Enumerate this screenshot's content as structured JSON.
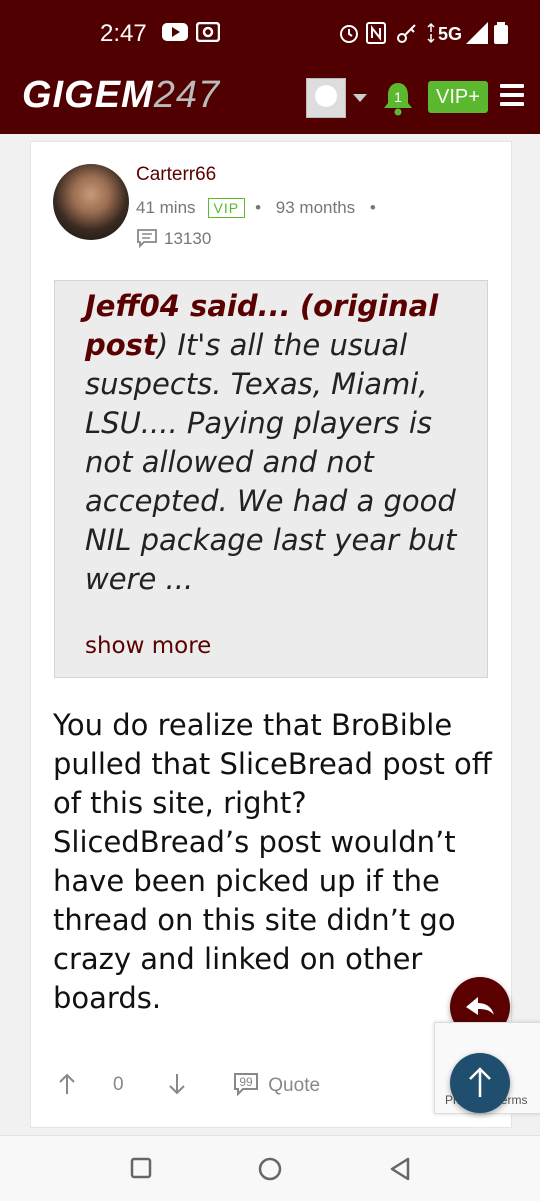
{
  "status_bar": {
    "time": "2:47",
    "network": "5G",
    "icons": [
      "youtube-icon",
      "cast-icon",
      "alarm-icon",
      "nfc-icon",
      "key-icon",
      "data-arrows-icon",
      "signal-icon",
      "battery-icon"
    ]
  },
  "header": {
    "logo_main": "GIGEM",
    "logo_num": "247",
    "notification_count": "1",
    "vip_label": "VIP+"
  },
  "post": {
    "username": "Carterr66",
    "time_ago": "41 mins",
    "vip_badge": "VIP",
    "tenure": "93 months",
    "post_count": "13130",
    "quote": {
      "author": "Jeff04 said...",
      "original_link": "(original post",
      "paren_close": ")",
      "text": " It's all the usual suspects. Texas, Miami, LSU.... Paying players is not allowed and not accepted. We had a good NIL package last year but were ...",
      "show_more": "show more"
    },
    "body": "You do realize that BroBible pulled that SliceBread post off of this site, right? SlicedBread’s post wouldn’t have been picked up if the thread on this site didn’t go crazy and linked on other boards.",
    "vote_count": "0",
    "quote_label": "Quote"
  },
  "recaptcha": {
    "text": "Privacy - Terms"
  },
  "colors": {
    "brand": "#500000",
    "vip_green": "#5cb82e",
    "fab_blue": "#1f4e6e"
  }
}
